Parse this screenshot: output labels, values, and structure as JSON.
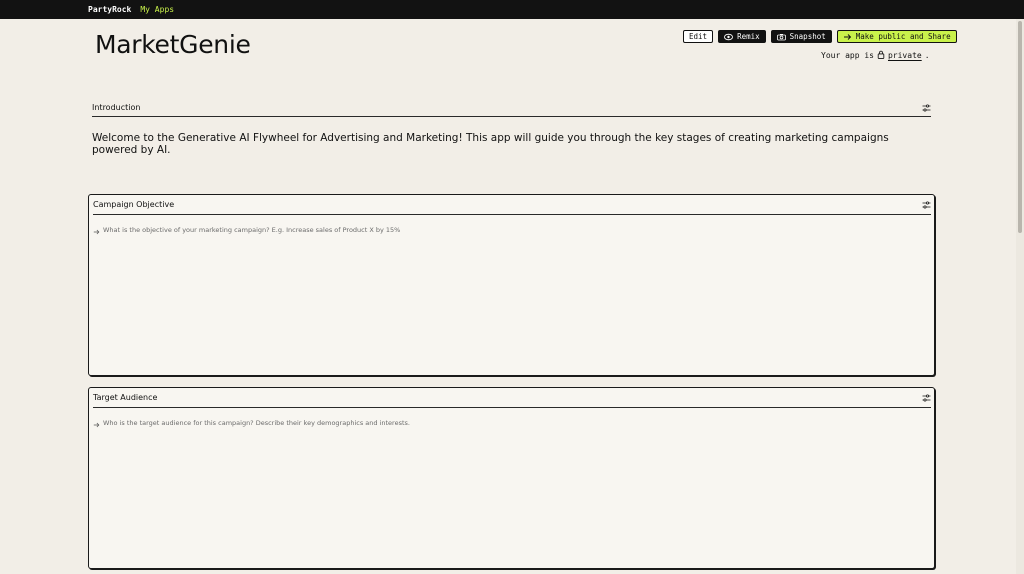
{
  "topbar": {
    "brand": "PartyRock",
    "my_apps": "My Apps"
  },
  "app": {
    "title": "MarketGenie"
  },
  "actions": {
    "edit": "Edit",
    "remix": "Remix",
    "snapshot": "Snapshot",
    "share": "Make public and Share"
  },
  "privacy": {
    "prefix": "Your app is",
    "status": "private",
    "suffix": "."
  },
  "intro": {
    "title": "Introduction",
    "text": "Welcome to the Generative AI Flywheel for Advertising and Marketing! This app will guide you through the key stages of creating marketing campaigns powered by AI."
  },
  "widgets": [
    {
      "title": "Campaign Objective",
      "placeholder": "What is the objective of your marketing campaign? E.g. Increase sales of Product X by 15%"
    },
    {
      "title": "Target Audience",
      "placeholder": "Who is the target audience for this campaign? Describe their key demographics and interests."
    }
  ],
  "colors": {
    "accent": "#c9f24b",
    "topbar": "#121212",
    "background": "#f2eee7",
    "card": "#f8f6f1"
  },
  "icons": {
    "remix": "eye-icon",
    "snapshot": "camera-icon",
    "share": "arrow-right-icon",
    "privacy": "lock-icon",
    "settings": "sliders-icon",
    "input": "arrow-right-icon"
  }
}
